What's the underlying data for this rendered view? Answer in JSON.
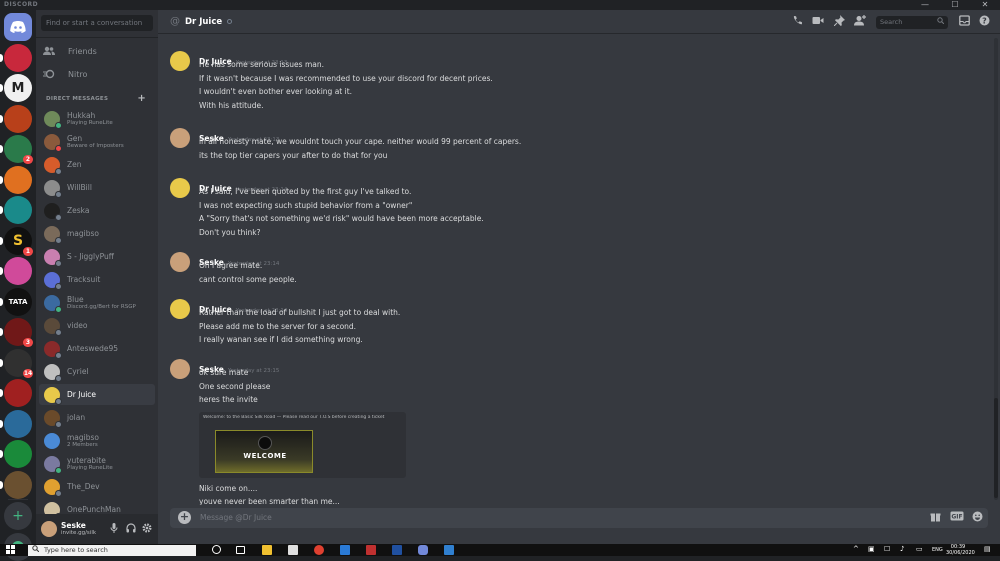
{
  "app": {
    "brand": "DISCORD"
  },
  "window": {
    "minimize": "—",
    "maximize": "☐",
    "close": "✕"
  },
  "sidebar": {
    "search_placeholder": "Find or start a conversation",
    "nav": [
      {
        "label": "Friends",
        "icon": "friends-icon"
      },
      {
        "label": "Nitro",
        "icon": "nitro-icon"
      }
    ],
    "dm_header": "DIRECT MESSAGES",
    "dm_add": "+",
    "dms": [
      {
        "name": "Hukkah",
        "sub": "Playing RuneLite",
        "color": "#6f8a5a",
        "status": "on"
      },
      {
        "name": "Gen",
        "sub": "Beware of Imposters",
        "color": "#8a5a3c",
        "status": "dnd"
      },
      {
        "name": "Zen",
        "sub": "",
        "color": "#d65c2b",
        "status": "off"
      },
      {
        "name": "WillBill",
        "sub": "",
        "color": "#8c8c8c",
        "status": "off"
      },
      {
        "name": "Zeska",
        "sub": "",
        "color": "#1f1f1f",
        "status": "off"
      },
      {
        "name": "magibso",
        "sub": "",
        "color": "#7a6a5a",
        "status": "off"
      },
      {
        "name": "S - JigglyPuff",
        "sub": "",
        "color": "#c97fb0",
        "status": "off"
      },
      {
        "name": "Tracksuit",
        "sub": "",
        "color": "#5b6fd6",
        "status": "off"
      },
      {
        "name": "Blue",
        "sub": "Discord.gg/Bert for RSGP",
        "color": "#3b6aa0",
        "status": "on"
      },
      {
        "name": "video",
        "sub": "",
        "color": "#5a4a3a",
        "status": "off"
      },
      {
        "name": "Anteswede95",
        "sub": "",
        "color": "#8a2a2a",
        "status": "off"
      },
      {
        "name": "Cyriel",
        "sub": "",
        "color": "#c0c0c0",
        "status": "off"
      },
      {
        "name": "Dr Juice",
        "sub": "",
        "color": "#e8c94a",
        "status": "off",
        "active": true
      },
      {
        "name": "jolan",
        "sub": "",
        "color": "#6a4a2a",
        "status": "off"
      },
      {
        "name": "magibso",
        "sub": "2 Members",
        "color": "#4a8ad6",
        "status": "none"
      },
      {
        "name": "yuterabite",
        "sub": "Playing RuneLite",
        "color": "#7a7aa0",
        "status": "on"
      },
      {
        "name": "The_Dev",
        "sub": "",
        "color": "#e0a030",
        "status": "off"
      },
      {
        "name": "OnePunchMan",
        "sub": "",
        "color": "#d0c0a0",
        "status": "off"
      }
    ]
  },
  "user": {
    "name": "Seske",
    "tag": "invite.gg/silk",
    "mic_icon": "microphone-icon",
    "headset_icon": "headset-icon",
    "settings_icon": "gear-icon"
  },
  "guilds": [
    {
      "label": "",
      "color": "#7289da",
      "icon": "home-icon"
    },
    {
      "label": "",
      "color": "#c8283c",
      "badge": ""
    },
    {
      "label": "M",
      "color": "#f0f0f0"
    },
    {
      "label": "",
      "color": "#b8401a"
    },
    {
      "label": "",
      "color": "#2a7a4a",
      "badge": "2"
    },
    {
      "label": "",
      "color": "#e07020"
    },
    {
      "label": "",
      "color": "#1a8a8a"
    },
    {
      "label": "S",
      "color": "#101010",
      "badge": "1"
    },
    {
      "label": "",
      "color": "#d04a9a"
    },
    {
      "label": "TATA",
      "color": "#111111"
    },
    {
      "label": "",
      "color": "#701818",
      "badge": "3"
    },
    {
      "label": "",
      "color": "#303030",
      "badge": "14"
    },
    {
      "label": "",
      "color": "#a02020"
    },
    {
      "label": "",
      "color": "#2a6a9a"
    },
    {
      "label": "",
      "color": "#1a8a3a"
    },
    {
      "label": "",
      "color": "#6a5030"
    }
  ],
  "guild_add": "+",
  "guild_explore": "compass-icon",
  "chat": {
    "header_at": "@",
    "title": "Dr Juice",
    "search_placeholder": "Search",
    "header_icons": [
      "phone-icon",
      "video-icon",
      "pin-icon",
      "add-member-icon",
      "inbox-icon",
      "help-icon"
    ],
    "messages": [
      {
        "author": "Dr Juice",
        "time": "Yesterday at 23:13",
        "avatar": "#e8c94a",
        "lines": [
          "He has some serious issues man.",
          "If it wasn't because I was recommended to use your discord for decent prices.",
          "I wouldn't even bother ever looking at it.",
          "With his attitude."
        ]
      },
      {
        "author": "Seske",
        "time": "Yesterday at 23:13",
        "avatar": "#c9a07a",
        "lines": [
          "in all honesty mate, we wouldnt touch your cape. neither would 99 percent of capers.",
          "its the top tier capers your after to do that for you"
        ]
      },
      {
        "author": "Dr Juice",
        "time": "Yesterday at 23:14",
        "avatar": "#e8c94a",
        "lines": [
          "As I said, I've been quoted by the first guy I've talked to.",
          "I was not expecting such stupid behavior from a \"owner\"",
          "A \"Sorry that's not something we'd risk\" would have been more acceptable.",
          "Don't you think?"
        ]
      },
      {
        "author": "Seske",
        "time": "Yesterday at 23:14",
        "avatar": "#c9a07a",
        "lines": [
          "Oh i agree mate.",
          "cant control some people."
        ]
      },
      {
        "author": "Dr Juice",
        "time": "Yesterday at 23:14",
        "avatar": "#e8c94a",
        "lines": [
          "Rather than the load of bullshit I just got to deal with.",
          "Please add me to the server for a second.",
          "I really wanan see if I did something wrong."
        ]
      },
      {
        "author": "Seske",
        "time": "Yesterday at 23:15",
        "avatar": "#c9a07a",
        "lines": [
          "ok sure mate",
          "One second please",
          "heres the invite"
        ],
        "after_embed": [
          "Niki come on....",
          "youve never been smarter than me..."
        ]
      }
    ],
    "embed": {
      "header": "Welcome: to the Basic Silk Road — Please read our T.O.S before creating a ticket",
      "title": "WELCOME"
    },
    "composer_placeholder": "Message @Dr Juice",
    "composer_icons": [
      "gift-icon",
      "gif-icon",
      "emoji-icon"
    ]
  },
  "taskbar": {
    "search_placeholder": "Type here to search",
    "time": "00:39",
    "date": "30/06/2020"
  }
}
